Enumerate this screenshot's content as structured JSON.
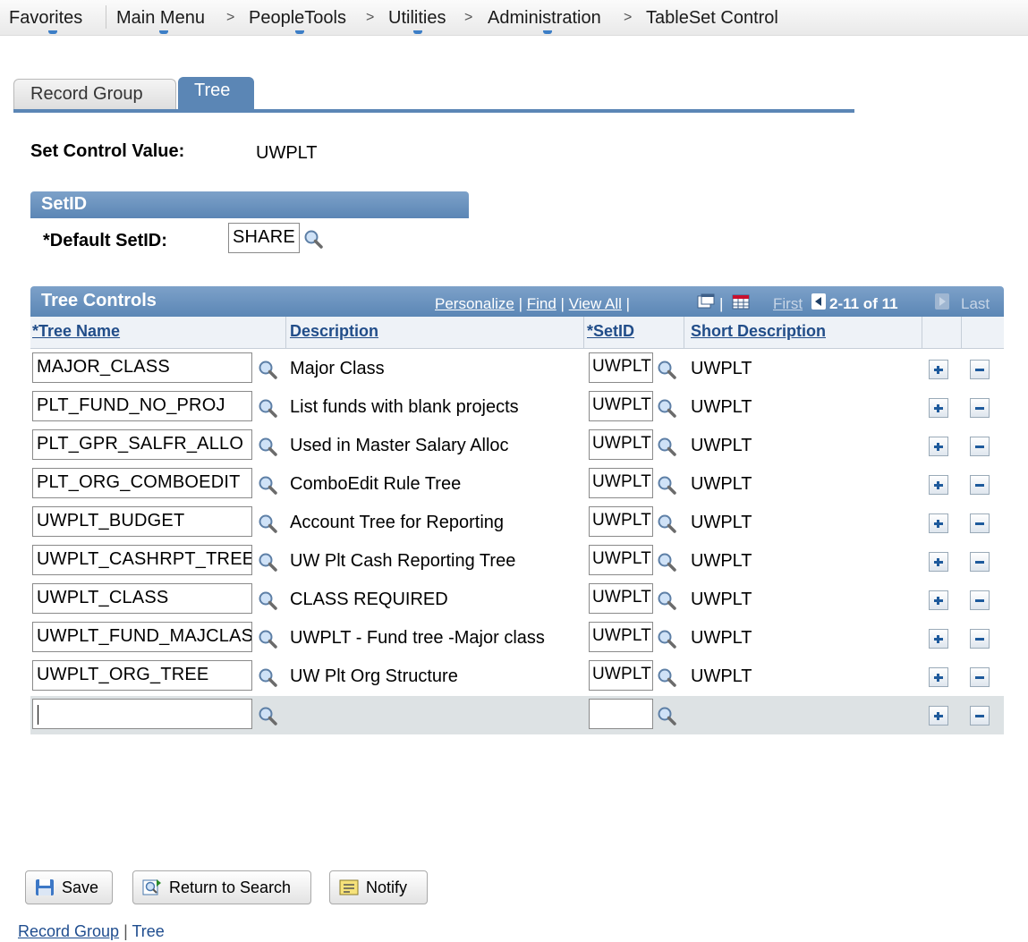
{
  "nav": {
    "favorites": "Favorites",
    "main_menu": "Main Menu",
    "sep": ">",
    "crumbs": [
      "PeopleTools",
      "Utilities",
      "Administration",
      "TableSet Control"
    ]
  },
  "tabs": [
    {
      "label": "Record Group",
      "active": false
    },
    {
      "label": "Tree",
      "active": true
    }
  ],
  "set_control": {
    "label": "Set Control Value:",
    "value": "UWPLT"
  },
  "setid_group": {
    "title": "SetID",
    "default_label": "*Default SetID:",
    "default_value": "SHARE"
  },
  "grid": {
    "title": "Tree Controls",
    "personalize": "Personalize",
    "find": "Find",
    "view_all": "View All",
    "pipe": "|",
    "first": "First",
    "range": "2-11 of 11",
    "last": "Last",
    "columns": [
      "*Tree Name",
      "Description",
      "*SetID",
      "Short Description"
    ],
    "rows": [
      {
        "tree_name": "MAJOR_CLASS",
        "description": "Major Class",
        "setid": "UWPLT",
        "short_desc": "UWPLT"
      },
      {
        "tree_name": "PLT_FUND_NO_PROJ",
        "description": "List funds with blank projects",
        "setid": "UWPLT",
        "short_desc": "UWPLT"
      },
      {
        "tree_name": "PLT_GPR_SALFR_ALLO",
        "description": "Used in Master Salary Alloc",
        "setid": "UWPLT",
        "short_desc": "UWPLT"
      },
      {
        "tree_name": "PLT_ORG_COMBOEDIT",
        "description": "ComboEdit Rule Tree",
        "setid": "UWPLT",
        "short_desc": "UWPLT"
      },
      {
        "tree_name": "UWPLT_BUDGET",
        "description": "Account Tree for Reporting",
        "setid": "UWPLT",
        "short_desc": "UWPLT"
      },
      {
        "tree_name": "UWPLT_CASHRPT_TREE",
        "description": "UW Plt Cash Reporting Tree",
        "setid": "UWPLT",
        "short_desc": "UWPLT"
      },
      {
        "tree_name": "UWPLT_CLASS",
        "description": "CLASS REQUIRED",
        "setid": "UWPLT",
        "short_desc": "UWPLT"
      },
      {
        "tree_name": "UWPLT_FUND_MAJCLAS",
        "description": "UWPLT - Fund tree -Major class",
        "setid": "UWPLT",
        "short_desc": "UWPLT"
      },
      {
        "tree_name": "UWPLT_ORG_TREE",
        "description": "UW Plt Org Structure",
        "setid": "UWPLT",
        "short_desc": "UWPLT"
      },
      {
        "tree_name": "",
        "description": "",
        "setid": "",
        "short_desc": ""
      }
    ]
  },
  "buttons": {
    "save": "Save",
    "return_to_search": "Return to Search",
    "notify": "Notify"
  },
  "bottom_links": {
    "record_group": "Record Group",
    "sep": "|",
    "tree": "Tree"
  }
}
